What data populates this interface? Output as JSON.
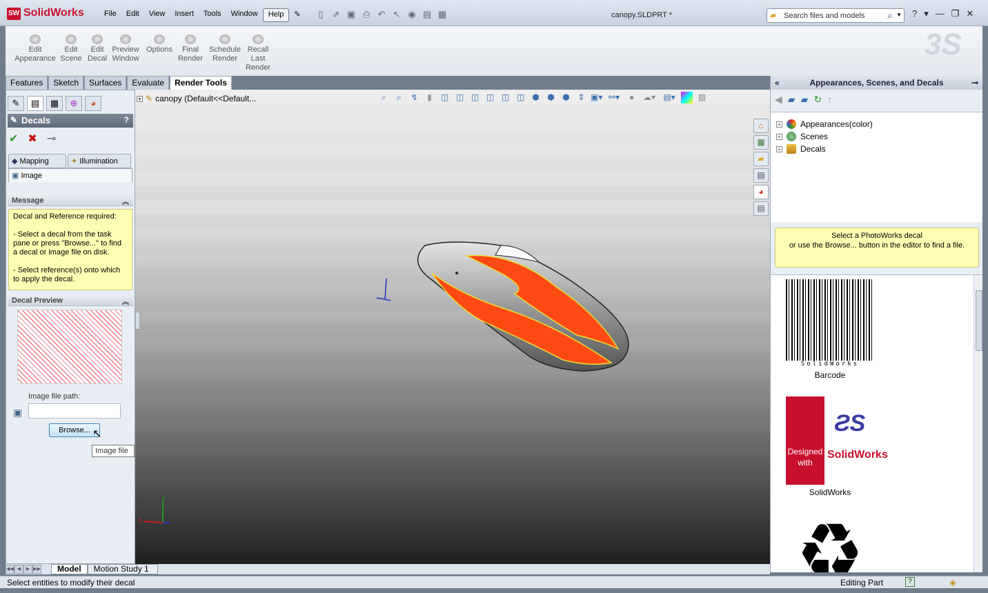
{
  "app": {
    "name": "SolidWorks",
    "logo_badge": "SW",
    "doc_title": "canopy.SLDPRT *"
  },
  "menu": [
    "File",
    "Edit",
    "View",
    "Insert",
    "Tools",
    "Window",
    "Help"
  ],
  "search": {
    "placeholder": "Search files and models"
  },
  "window_controls": [
    "?",
    "▾",
    "—",
    "❐",
    "✕"
  ],
  "command_manager": [
    {
      "label": "Edit\nAppearance"
    },
    {
      "label": "Edit\nScene"
    },
    {
      "label": "Edit\nDecal"
    },
    {
      "label": "Preview\nWindow"
    },
    {
      "label": "Options"
    },
    {
      "label": "Final\nRender"
    },
    {
      "label": "Schedule\nRender"
    },
    {
      "label": "Recall\nLast\nRender"
    }
  ],
  "tabs": [
    "Features",
    "Sketch",
    "Surfaces",
    "Evaluate",
    "Render Tools"
  ],
  "active_tab": "Render Tools",
  "left_panel": {
    "title": "Decals",
    "help": "?",
    "subtabs": [
      "Mapping",
      "Illumination"
    ],
    "image_tab": "Image",
    "message_header": "Message",
    "message": "Decal and Reference required:\n\n- Select a decal from the task pane or press \"Browse...\" to find a decal or image file on disk.\n\n- Select reference(s) onto which to apply the decal.",
    "preview_header": "Decal Preview",
    "image_path_label": "Image file path:",
    "image_path_value": "",
    "browse_label": "Browse...",
    "tooltip": "Image file"
  },
  "viewport": {
    "tree_root": "canopy  (Default<<Default..."
  },
  "right_panel": {
    "title": "Appearances, Scenes, and Decals",
    "tree": [
      {
        "label": "Appearances(color)",
        "color": "#e8a020"
      },
      {
        "label": "Scenes",
        "color": "#3a8a3a"
      },
      {
        "label": "Decals",
        "color": "#d4a020"
      }
    ],
    "message": "Select a PhotoWorks decal\nor use the Browse... button in the editor to find a file.",
    "gallery": [
      {
        "label": "Barcode",
        "barcode_text": "SolidWorks"
      },
      {
        "label": "SolidWorks",
        "caption": "Designed\nwith",
        "brand": "SolidWorks"
      },
      {
        "label": ""
      }
    ]
  },
  "bottom_tabs": [
    "Model",
    "Motion Study 1"
  ],
  "status": {
    "left": "Select entities to modify their decal",
    "mode": "Editing Part"
  },
  "colors": {
    "accent_red": "#c8102e",
    "decal_orange": "#ff4a14",
    "stripe_yellow": "#e8e030"
  }
}
